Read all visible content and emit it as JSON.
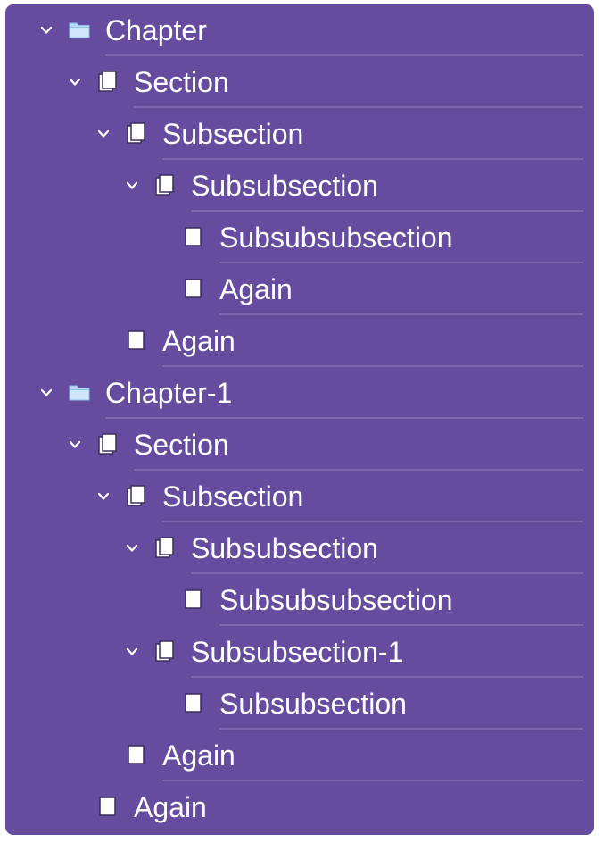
{
  "outline": {
    "rows": [
      {
        "label": "Chapter",
        "icon": "folder-icon",
        "expandable": true
      },
      {
        "label": "Section",
        "icon": "pages-icon",
        "expandable": true
      },
      {
        "label": "Subsection",
        "icon": "pages-icon",
        "expandable": true
      },
      {
        "label": "Subsubsection",
        "icon": "pages-icon",
        "expandable": true
      },
      {
        "label": "Subsubsubsection",
        "icon": "page-icon",
        "expandable": false
      },
      {
        "label": "Again",
        "icon": "page-icon",
        "expandable": false
      },
      {
        "label": "Again",
        "icon": "page-icon",
        "expandable": false
      },
      {
        "label": "Chapter-1",
        "icon": "folder-icon",
        "expandable": true
      },
      {
        "label": "Section",
        "icon": "pages-icon",
        "expandable": true
      },
      {
        "label": "Subsection",
        "icon": "pages-icon",
        "expandable": true
      },
      {
        "label": "Subsubsection",
        "icon": "pages-icon",
        "expandable": true
      },
      {
        "label": "Subsubsubsection",
        "icon": "page-icon",
        "expandable": false
      },
      {
        "label": "Subsubsection-1",
        "icon": "pages-icon",
        "expandable": true
      },
      {
        "label": "Subsubsection",
        "icon": "page-icon",
        "expandable": false
      },
      {
        "label": "Again",
        "icon": "page-icon",
        "expandable": false
      },
      {
        "label": "Again",
        "icon": "page-icon",
        "expandable": false
      }
    ]
  },
  "colors": {
    "panel_background": "#654c9e",
    "separator": "#7d68b0",
    "text": "#ffffff",
    "folder": "#b9dbf7"
  }
}
